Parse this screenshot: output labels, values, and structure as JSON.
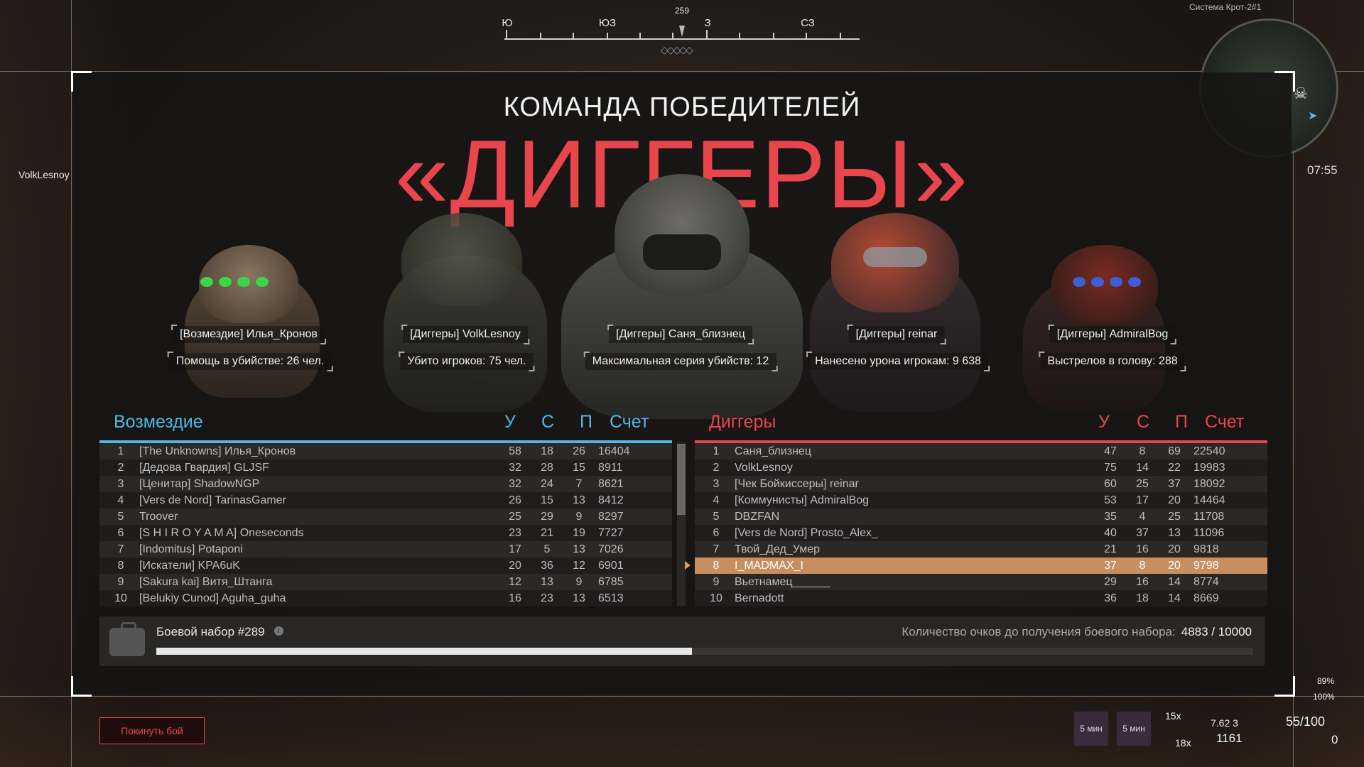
{
  "compass": {
    "heading": "259",
    "labels": [
      "Ю",
      "ЮЗ",
      "З",
      "СЗ"
    ]
  },
  "title": {
    "small": "КОМАНДА ПОБЕДИТЕЛЕЙ",
    "big": "«ДИГГЕРЫ»"
  },
  "highlights": [
    {
      "name": "[Возмездие] Илья_Кронов",
      "stat": "Помощь в убийстве: 26 чел."
    },
    {
      "name": "[Диггеры] VolkLesnoy",
      "stat": "Убито игроков: 75 чел."
    },
    {
      "name": "[Диггеры] Саня_близнец",
      "stat": "Максимальная серия убийств: 12"
    },
    {
      "name": "[Диггеры] reinar",
      "stat": "Нанесено урона игрокам: 9 638"
    },
    {
      "name": "[Диггеры] AdmiralBog",
      "stat": "Выстрелов в голову: 288"
    }
  ],
  "columns": {
    "k": "У",
    "d": "С",
    "a": "П",
    "score": "Счет"
  },
  "team_left": {
    "name": "Возмездие",
    "color": "#4fb8e6",
    "rows": [
      {
        "rank": "1",
        "name": "[The Unknowns] Илья_Кронов",
        "k": "58",
        "d": "18",
        "a": "26",
        "score": "16404"
      },
      {
        "rank": "2",
        "name": "[Дедова Гвардия] GLJSF",
        "k": "32",
        "d": "28",
        "a": "15",
        "score": "8911"
      },
      {
        "rank": "3",
        "name": "[Ценитар] ShadowNGP",
        "k": "32",
        "d": "24",
        "a": "7",
        "score": "8621"
      },
      {
        "rank": "4",
        "name": "[Vers de Nord] TarinasGamer",
        "k": "26",
        "d": "15",
        "a": "13",
        "score": "8412"
      },
      {
        "rank": "5",
        "name": "Troover",
        "k": "25",
        "d": "29",
        "a": "9",
        "score": "8297"
      },
      {
        "rank": "6",
        "name": "[S H I R O Y A M A] Oneseconds",
        "k": "23",
        "d": "21",
        "a": "19",
        "score": "7727"
      },
      {
        "rank": "7",
        "name": "[Indomitus] Potaponi",
        "k": "17",
        "d": "5",
        "a": "13",
        "score": "7026"
      },
      {
        "rank": "8",
        "name": "[Искатели] KPA6uK",
        "k": "20",
        "d": "36",
        "a": "12",
        "score": "6901"
      },
      {
        "rank": "9",
        "name": "[Sakura kai] Витя_Штанга",
        "k": "12",
        "d": "13",
        "a": "9",
        "score": "6785"
      },
      {
        "rank": "10",
        "name": "[Belukiy Cunod] Aguha_guha",
        "k": "16",
        "d": "23",
        "a": "13",
        "score": "6513"
      }
    ]
  },
  "team_right": {
    "name": "Диггеры",
    "color": "#e8464c",
    "rows": [
      {
        "rank": "1",
        "name": "Саня_близнец",
        "k": "47",
        "d": "8",
        "a": "69",
        "score": "22540"
      },
      {
        "rank": "2",
        "name": "VolkLesnoy",
        "k": "75",
        "d": "14",
        "a": "22",
        "score": "19983"
      },
      {
        "rank": "3",
        "name": "[Чек Бойкиссеры] reinar",
        "k": "60",
        "d": "25",
        "a": "37",
        "score": "18092"
      },
      {
        "rank": "4",
        "name": "[Коммунисты] AdmiralBog",
        "k": "53",
        "d": "17",
        "a": "20",
        "score": "14464"
      },
      {
        "rank": "5",
        "name": "DBZFAN",
        "k": "35",
        "d": "4",
        "a": "25",
        "score": "11708"
      },
      {
        "rank": "6",
        "name": "[Vers de Nord] Prosto_Alex_",
        "k": "40",
        "d": "37",
        "a": "13",
        "score": "11096"
      },
      {
        "rank": "7",
        "name": "Твой_Дед_Умер",
        "k": "21",
        "d": "16",
        "a": "20",
        "score": "9818"
      },
      {
        "rank": "8",
        "name": "I_MADMAX_I",
        "k": "37",
        "d": "8",
        "a": "20",
        "score": "9798",
        "highlight": true
      },
      {
        "rank": "9",
        "name": "Вьетнамец______",
        "k": "29",
        "d": "16",
        "a": "14",
        "score": "8774"
      },
      {
        "rank": "10",
        "name": "Bernadott",
        "k": "36",
        "d": "18",
        "a": "14",
        "score": "8669"
      }
    ]
  },
  "kit": {
    "title": "Боевой набор #289",
    "progress_label": "Количество очков до получения боевого набора:",
    "progress_text": "4883 / 10000",
    "progress_fraction": 0.4883
  },
  "leave_button": "Покинуть бой",
  "minimap": {
    "title": "Система Крот-2#1",
    "time": "07:55"
  },
  "player_label": "VolkLesnoy",
  "hud": {
    "slot1": "5 мин",
    "slot2": "5 мин",
    "item_count_top": "15x",
    "item_count_bottom": "18x",
    "ammo_type": "7.62 3",
    "ammo_reserve": "1161",
    "health": "55/100",
    "armor": "0",
    "pct_top": "89%",
    "pct_bottom": "100%"
  }
}
